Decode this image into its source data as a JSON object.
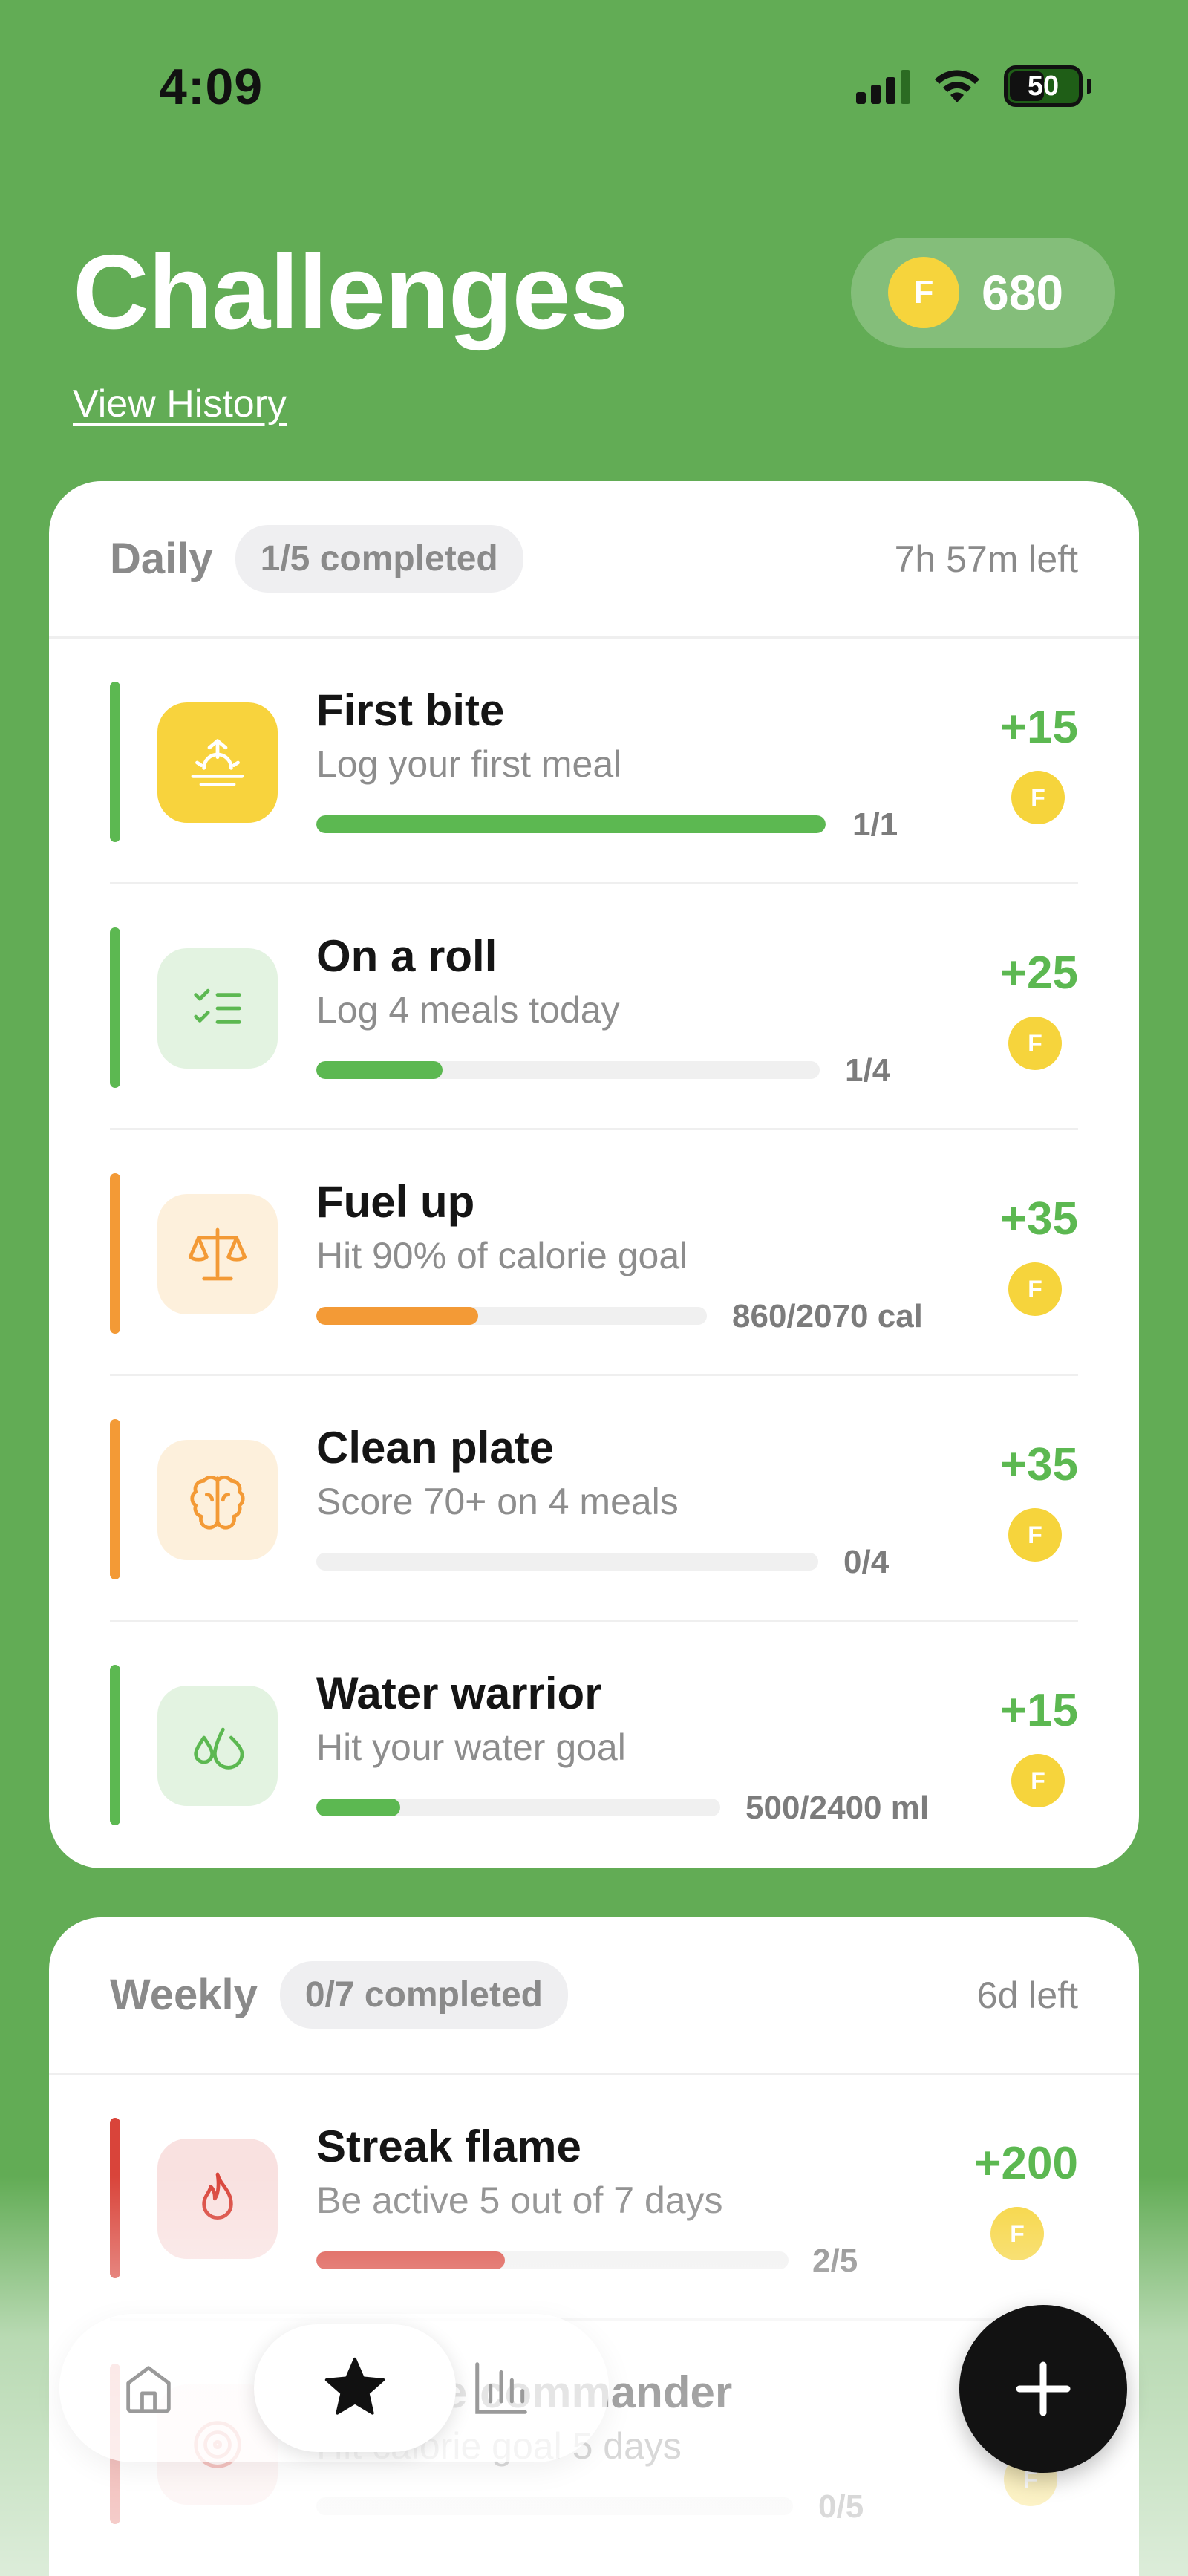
{
  "status_bar": {
    "time": "4:09",
    "battery": "50"
  },
  "header": {
    "title": "Challenges",
    "history_link": "View History",
    "coin_symbol": "F",
    "coin_balance": "680"
  },
  "daily": {
    "title": "Daily",
    "completed": "1/5 completed",
    "time_left": "7h 57m left",
    "items": [
      {
        "title": "First bite",
        "description": "Log your first meal",
        "progress_label": "1/1",
        "progress": 1.0,
        "reward": "+15",
        "accent": "#5cb851",
        "icon": "sunrise-icon"
      },
      {
        "title": "On a roll",
        "description": "Log 4 meals today",
        "progress_label": "1/4",
        "progress": 0.25,
        "reward": "+25",
        "accent": "#5cb851",
        "icon": "checklist-icon"
      },
      {
        "title": "Fuel up",
        "description": "Hit 90% of calorie goal",
        "progress_label": "860/2070 cal",
        "progress": 0.415,
        "reward": "+35",
        "accent": "#f39a36",
        "icon": "scale-icon"
      },
      {
        "title": "Clean plate",
        "description": "Score 70+ on 4 meals",
        "progress_label": "0/4",
        "progress": 0.0,
        "reward": "+35",
        "accent": "#f39a36",
        "icon": "brain-icon"
      },
      {
        "title": "Water warrior",
        "description": "Hit your water goal",
        "progress_label": "500/2400 ml",
        "progress": 0.208,
        "reward": "+15",
        "accent": "#5cb851",
        "icon": "droplets-icon"
      }
    ]
  },
  "weekly": {
    "title": "Weekly",
    "completed": "0/7 completed",
    "time_left": "6d left",
    "items": [
      {
        "title": "Streak flame",
        "description": "Be active 5 out of 7 days",
        "progress_label": "2/5",
        "progress": 0.4,
        "reward": "+200",
        "accent": "#d9443a",
        "icon": "flame-icon"
      },
      {
        "title": "Calorie commander",
        "description": "Hit calorie goal 5 days",
        "progress_label": "0/5",
        "progress": 0.0,
        "reward": "",
        "accent": "#d9443a",
        "icon": "target-icon"
      }
    ]
  },
  "nav": {
    "active": "challenges"
  },
  "colors": {
    "background": "#62ac55",
    "coin": "#f6d43c",
    "reward": "#5cb851"
  }
}
